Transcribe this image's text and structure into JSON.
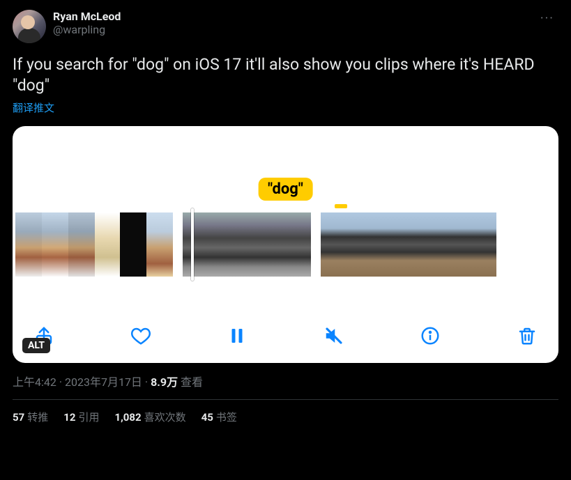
{
  "author": {
    "display_name": "Ryan McLeod",
    "handle": "@warpling"
  },
  "tweet_text": "If you search for \"dog\" on iOS 17 it'll also show you clips where it's HEARD \"dog\"",
  "translate_label": "翻译推文",
  "media": {
    "badge": "\"dog\"",
    "alt_badge": "ALT"
  },
  "meta": {
    "time": "上午4:42",
    "date": "2023年7月17日",
    "views_number": "8.9万",
    "views_label": "查看"
  },
  "stats": {
    "retweets": {
      "count": "57",
      "label": "转推"
    },
    "quotes": {
      "count": "12",
      "label": "引用"
    },
    "likes": {
      "count": "1,082",
      "label": "喜欢次数"
    },
    "bookmarks": {
      "count": "45",
      "label": "书签"
    }
  }
}
